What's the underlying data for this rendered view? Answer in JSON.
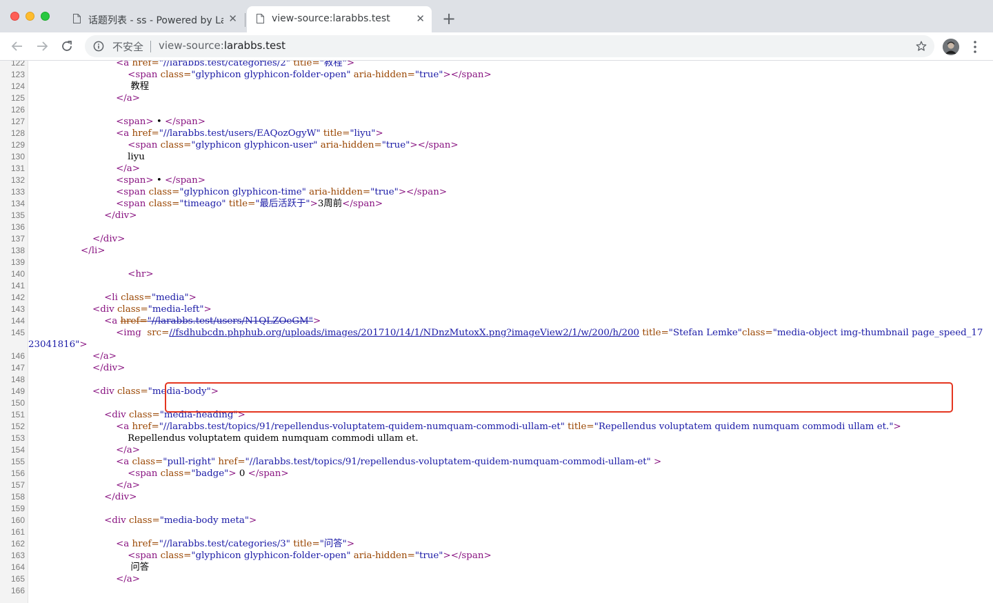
{
  "window": {
    "tabs": [
      {
        "title": "话题列表 - ss - Powered by Lar",
        "active": false
      },
      {
        "title": "view-source:larabbs.test",
        "active": true
      }
    ]
  },
  "toolbar": {
    "security_label": "不安全",
    "url_scheme": "view-source:",
    "url_host": "larabbs.test"
  },
  "colors": {
    "tag": "#881280",
    "attr_name": "#994500",
    "attr_value": "#1a1aa6",
    "line_number": "#7a7a7a",
    "highlight_border": "#e4351f"
  },
  "source": {
    "lines": [
      {
        "n": "122",
        "segs": [
          [
            "",
            "            "
          ],
          [
            "tag",
            "<a "
          ],
          [
            "an",
            "href="
          ],
          [
            "av",
            "\"//larabbs.test/categories/2\""
          ],
          [
            "an",
            " title="
          ],
          [
            "av",
            "\"教程\""
          ],
          [
            "tag",
            ">"
          ]
        ]
      },
      {
        "n": "123",
        "segs": [
          [
            "",
            "                "
          ],
          [
            "tag",
            "<span "
          ],
          [
            "an",
            "class="
          ],
          [
            "av",
            "\"glyphicon glyphicon-folder-open\""
          ],
          [
            "an",
            " aria-hidden="
          ],
          [
            "av",
            "\"true\""
          ],
          [
            "tag",
            "></span>"
          ]
        ]
      },
      {
        "n": "124",
        "segs": [
          [
            "",
            "                 教程"
          ]
        ]
      },
      {
        "n": "125",
        "segs": [
          [
            "",
            "            "
          ],
          [
            "tag",
            "</a>"
          ]
        ]
      },
      {
        "n": "126",
        "segs": [
          [
            "",
            ""
          ]
        ]
      },
      {
        "n": "127",
        "segs": [
          [
            "",
            "            "
          ],
          [
            "tag",
            "<span>"
          ],
          [
            "",
            " • "
          ],
          [
            "tag",
            "</span>"
          ]
        ]
      },
      {
        "n": "128",
        "segs": [
          [
            "",
            "            "
          ],
          [
            "tag",
            "<a "
          ],
          [
            "an",
            "href="
          ],
          [
            "av",
            "\"//larabbs.test/users/EAQozOgyW\""
          ],
          [
            "an",
            " title="
          ],
          [
            "av",
            "\"liyu\""
          ],
          [
            "tag",
            ">"
          ]
        ]
      },
      {
        "n": "129",
        "segs": [
          [
            "",
            "                "
          ],
          [
            "tag",
            "<span "
          ],
          [
            "an",
            "class="
          ],
          [
            "av",
            "\"glyphicon glyphicon-user\""
          ],
          [
            "an",
            " aria-hidden="
          ],
          [
            "av",
            "\"true\""
          ],
          [
            "tag",
            "></span>"
          ]
        ]
      },
      {
        "n": "130",
        "segs": [
          [
            "",
            "                liyu"
          ]
        ]
      },
      {
        "n": "131",
        "segs": [
          [
            "",
            "            "
          ],
          [
            "tag",
            "</a>"
          ]
        ]
      },
      {
        "n": "132",
        "segs": [
          [
            "",
            "            "
          ],
          [
            "tag",
            "<span>"
          ],
          [
            "",
            " • "
          ],
          [
            "tag",
            "</span>"
          ]
        ]
      },
      {
        "n": "133",
        "segs": [
          [
            "",
            "            "
          ],
          [
            "tag",
            "<span "
          ],
          [
            "an",
            "class="
          ],
          [
            "av",
            "\"glyphicon glyphicon-time\""
          ],
          [
            "an",
            " aria-hidden="
          ],
          [
            "av",
            "\"true\""
          ],
          [
            "tag",
            "></span>"
          ]
        ]
      },
      {
        "n": "134",
        "segs": [
          [
            "",
            "            "
          ],
          [
            "tag",
            "<span "
          ],
          [
            "an",
            "class="
          ],
          [
            "av",
            "\"timeago\""
          ],
          [
            "an",
            " title="
          ],
          [
            "av",
            "\"最后活跃于\""
          ],
          [
            "tag",
            ">"
          ],
          [
            "",
            "3周前"
          ],
          [
            "tag",
            "</span>"
          ]
        ]
      },
      {
        "n": "135",
        "segs": [
          [
            "",
            "        "
          ],
          [
            "tag",
            "</div>"
          ]
        ]
      },
      {
        "n": "136",
        "segs": [
          [
            "",
            ""
          ]
        ]
      },
      {
        "n": "137",
        "segs": [
          [
            "",
            "    "
          ],
          [
            "tag",
            "</div>"
          ]
        ]
      },
      {
        "n": "138",
        "segs": [
          [
            "",
            "</li>"
          ]
        ],
        "tagline": true
      },
      {
        "n": "139",
        "segs": [
          [
            "",
            ""
          ]
        ]
      },
      {
        "n": "140",
        "segs": [
          [
            "",
            "                "
          ],
          [
            "tag",
            "<hr>"
          ]
        ]
      },
      {
        "n": "141",
        "segs": [
          [
            "",
            ""
          ]
        ]
      },
      {
        "n": "142",
        "segs": [
          [
            "",
            "        "
          ],
          [
            "tag",
            "<li "
          ],
          [
            "an",
            "class="
          ],
          [
            "av",
            "\"media\""
          ],
          [
            "tag",
            ">"
          ]
        ]
      },
      {
        "n": "143",
        "segs": [
          [
            "",
            "    "
          ],
          [
            "tag",
            "<div "
          ],
          [
            "an",
            "class="
          ],
          [
            "av",
            "\"media-left\""
          ],
          [
            "tag",
            ">"
          ]
        ]
      },
      {
        "n": "144",
        "segs": [
          [
            "",
            "        "
          ],
          [
            "tag",
            "<a "
          ],
          [
            "an strike",
            "href="
          ],
          [
            "av strike",
            "\"//larabbs.test/users/N1QLZOeGM\""
          ],
          [
            "tag",
            ">"
          ]
        ]
      },
      {
        "n": "145",
        "segs": [
          [
            "",
            "            "
          ],
          [
            "tag",
            "<img  "
          ],
          [
            "an",
            "src="
          ],
          [
            "lnk",
            "//fsdhubcdn.phphub.org/uploads/images/201710/14/1/NDnzMutoxX.png?imageView2/1/w/200/h/200"
          ],
          [
            "an",
            " title="
          ],
          [
            "av",
            "\"Stefan Lemke\""
          ],
          [
            "an",
            "class="
          ],
          [
            "av",
            "\"media-object img-thumbnail page_speed_1723041816\""
          ],
          [
            "tag",
            ">"
          ]
        ],
        "wrap": true
      },
      {
        "n": "146",
        "segs": [
          [
            "",
            "    "
          ],
          [
            "tag",
            "</a>"
          ]
        ]
      },
      {
        "n": "147",
        "segs": [
          [
            "",
            "    "
          ],
          [
            "tag",
            "</div>"
          ]
        ]
      },
      {
        "n": "148",
        "segs": [
          [
            "",
            ""
          ]
        ]
      },
      {
        "n": "149",
        "segs": [
          [
            "",
            "    "
          ],
          [
            "tag",
            "<div "
          ],
          [
            "an",
            "class="
          ],
          [
            "av",
            "\"media-body\""
          ],
          [
            "tag",
            ">"
          ]
        ]
      },
      {
        "n": "150",
        "segs": [
          [
            "",
            ""
          ]
        ]
      },
      {
        "n": "151",
        "segs": [
          [
            "",
            "        "
          ],
          [
            "tag",
            "<div "
          ],
          [
            "an",
            "class="
          ],
          [
            "av",
            "\"media-heading\""
          ],
          [
            "tag",
            ">"
          ]
        ]
      },
      {
        "n": "152",
        "segs": [
          [
            "",
            "            "
          ],
          [
            "tag",
            "<a "
          ],
          [
            "an",
            "href="
          ],
          [
            "av",
            "\"//larabbs.test/topics/91/repellendus-voluptatem-quidem-numquam-commodi-ullam-et\""
          ],
          [
            "an",
            " title="
          ],
          [
            "av",
            "\"Repellendus voluptatem quidem numquam commodi ullam et.\""
          ],
          [
            "tag",
            ">"
          ]
        ],
        "wrap": true
      },
      {
        "n": "153",
        "segs": [
          [
            "",
            "                Repellendus voluptatem quidem numquam commodi ullam et."
          ]
        ]
      },
      {
        "n": "154",
        "segs": [
          [
            "",
            "            "
          ],
          [
            "tag",
            "</a>"
          ]
        ]
      },
      {
        "n": "155",
        "segs": [
          [
            "",
            "            "
          ],
          [
            "tag",
            "<a "
          ],
          [
            "an",
            "class="
          ],
          [
            "av",
            "\"pull-right\""
          ],
          [
            "an",
            " href="
          ],
          [
            "av",
            "\"//larabbs.test/topics/91/repellendus-voluptatem-quidem-numquam-commodi-ullam-et\""
          ],
          [
            "",
            " "
          ],
          [
            "tag",
            ">"
          ]
        ]
      },
      {
        "n": "156",
        "segs": [
          [
            "",
            "                "
          ],
          [
            "tag",
            "<span "
          ],
          [
            "an",
            "class="
          ],
          [
            "av",
            "\"badge\""
          ],
          [
            "tag",
            ">"
          ],
          [
            "",
            " 0 "
          ],
          [
            "tag",
            "</span>"
          ]
        ]
      },
      {
        "n": "157",
        "segs": [
          [
            "",
            "            "
          ],
          [
            "tag",
            "</a>"
          ]
        ]
      },
      {
        "n": "158",
        "segs": [
          [
            "",
            "        "
          ],
          [
            "tag",
            "</div>"
          ]
        ]
      },
      {
        "n": "159",
        "segs": [
          [
            "",
            ""
          ]
        ]
      },
      {
        "n": "160",
        "segs": [
          [
            "",
            "        "
          ],
          [
            "tag",
            "<div "
          ],
          [
            "an",
            "class="
          ],
          [
            "av",
            "\"media-body meta\""
          ],
          [
            "tag",
            ">"
          ]
        ]
      },
      {
        "n": "161",
        "segs": [
          [
            "",
            ""
          ]
        ]
      },
      {
        "n": "162",
        "segs": [
          [
            "",
            "            "
          ],
          [
            "tag",
            "<a "
          ],
          [
            "an",
            "href="
          ],
          [
            "av",
            "\"//larabbs.test/categories/3\""
          ],
          [
            "an",
            " title="
          ],
          [
            "av",
            "\"问答\""
          ],
          [
            "tag",
            ">"
          ]
        ]
      },
      {
        "n": "163",
        "segs": [
          [
            "",
            "                "
          ],
          [
            "tag",
            "<span "
          ],
          [
            "an",
            "class="
          ],
          [
            "av",
            "\"glyphicon glyphicon-folder-open\""
          ],
          [
            "an",
            " aria-hidden="
          ],
          [
            "av",
            "\"true\""
          ],
          [
            "tag",
            "></span>"
          ]
        ]
      },
      {
        "n": "164",
        "segs": [
          [
            "",
            "                 问答"
          ]
        ]
      },
      {
        "n": "165",
        "segs": [
          [
            "",
            "            "
          ],
          [
            "tag",
            "</a>"
          ]
        ]
      },
      {
        "n": "166",
        "segs": [
          [
            "",
            ""
          ]
        ]
      }
    ]
  }
}
